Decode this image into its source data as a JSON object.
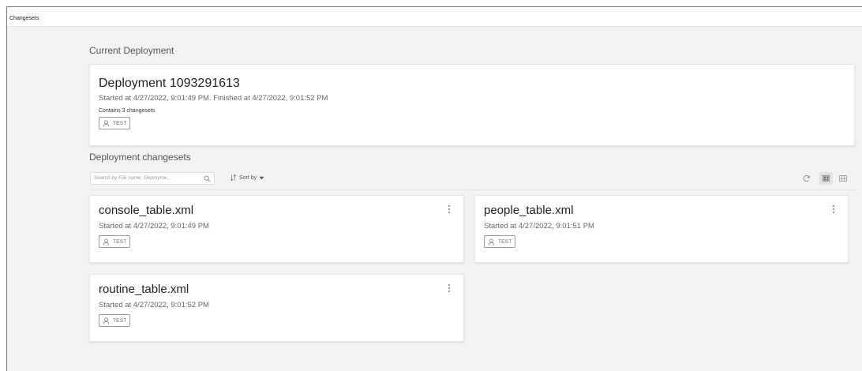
{
  "app": {
    "title": "Changesets"
  },
  "current": {
    "section_title": "Current Deployment",
    "deployment_title": "Deployment 1093291613",
    "timing": "Started at 4/27/2022, 9:01:49 PM. Finished at 4/27/2022, 9:01:52 PM",
    "contains": "Contains 3 changesets",
    "badge": "TEST"
  },
  "changesets": {
    "section_title": "Deployment changesets",
    "search_placeholder": "Search by File name, Deployme...",
    "sort_label": "Sort by",
    "items": [
      {
        "name": "console_table.xml",
        "started": "Started at 4/27/2022, 9:01:49 PM",
        "badge": "TEST"
      },
      {
        "name": "people_table.xml",
        "started": "Started at 4/27/2022, 9:01:51 PM",
        "badge": "TEST"
      },
      {
        "name": "routine_table.xml",
        "started": "Started at 4/27/2022, 9:01:52 PM",
        "badge": "TEST"
      }
    ]
  },
  "icons": {
    "search": "search-icon",
    "sort": "sort-icon",
    "dropdown": "caret-down-icon",
    "refresh": "refresh-icon",
    "grid_view": "grid-view-icon",
    "list_view": "list-view-icon",
    "user": "user-icon",
    "more": "kebab-menu-icon"
  }
}
